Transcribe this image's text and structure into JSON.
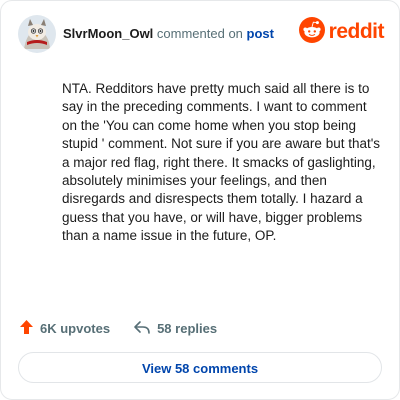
{
  "header": {
    "username": "SlvrMoon_Owl",
    "action_text": "commented on",
    "post_link": "post",
    "brand": "reddit"
  },
  "comment": {
    "body": "NTA. Redditors have pretty much said all there is to say in the preceding comments. I want to comment on the 'You can come home when you stop being stupid ' comment. Not sure if you are aware but that's a major red flag, right there. It smacks of gaslighting, absolutely minimises your feelings, and then disregards and disrespects them totally. I hazard a guess that you have, or will have, bigger problems than a name issue in the future, OP."
  },
  "actions": {
    "upvotes": "6K upvotes",
    "replies": "58 replies"
  },
  "footer": {
    "view_comments": "View 58 comments"
  },
  "colors": {
    "brand": "#ff4500",
    "link": "#0045ac",
    "muted": "#576f76",
    "text": "#1c1c1c"
  },
  "icons": {
    "upvote": "upvote-arrow-icon",
    "reply": "reply-arrow-icon",
    "brand": "reddit-snoo-icon"
  }
}
